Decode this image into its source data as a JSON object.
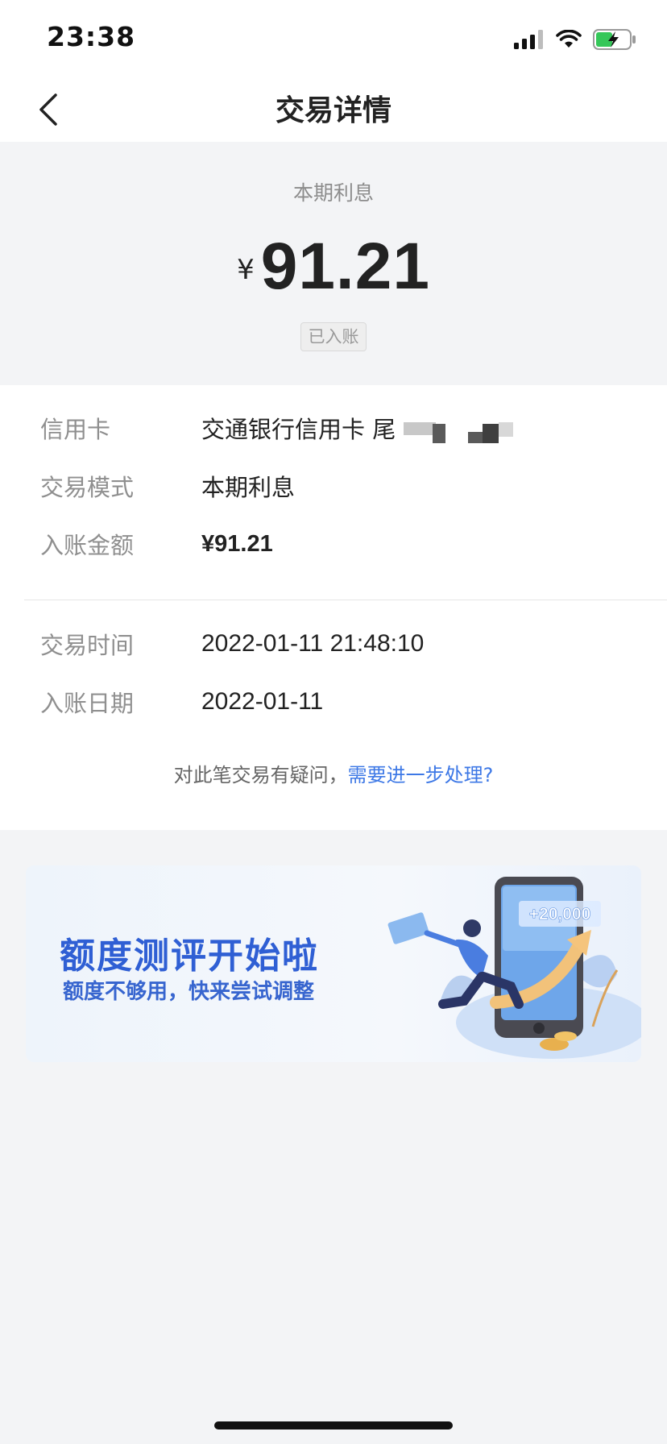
{
  "status_bar": {
    "time": "23:38"
  },
  "nav": {
    "title": "交易详情"
  },
  "summary": {
    "label": "本期利息",
    "currency_symbol": "¥",
    "amount": "91.21",
    "status": "已入账"
  },
  "details": {
    "rows": [
      {
        "label": "信用卡",
        "value": "交通银行信用卡 尾"
      },
      {
        "label": "交易模式",
        "value": "本期利息"
      },
      {
        "label": "入账金额",
        "value": "¥91.21"
      },
      {
        "label": "交易时间",
        "value": "2022-01-11 21:48:10"
      },
      {
        "label": "入账日期",
        "value": "2022-01-11"
      }
    ],
    "query_text": "对此笔交易有疑问，",
    "query_link": "需要进一步处理?"
  },
  "banner": {
    "title": "额度测评开始啦",
    "subtitle": "额度不够用，快来尝试调整",
    "badge": "+20,000"
  },
  "colors": {
    "accent_blue": "#3d78e6",
    "banner_title": "#2f5fd4",
    "background": "#f3f4f6"
  },
  "icons": [
    "signal-icon",
    "wifi-icon",
    "battery-charging-icon",
    "back-arrow-icon",
    "phone-illustration"
  ]
}
